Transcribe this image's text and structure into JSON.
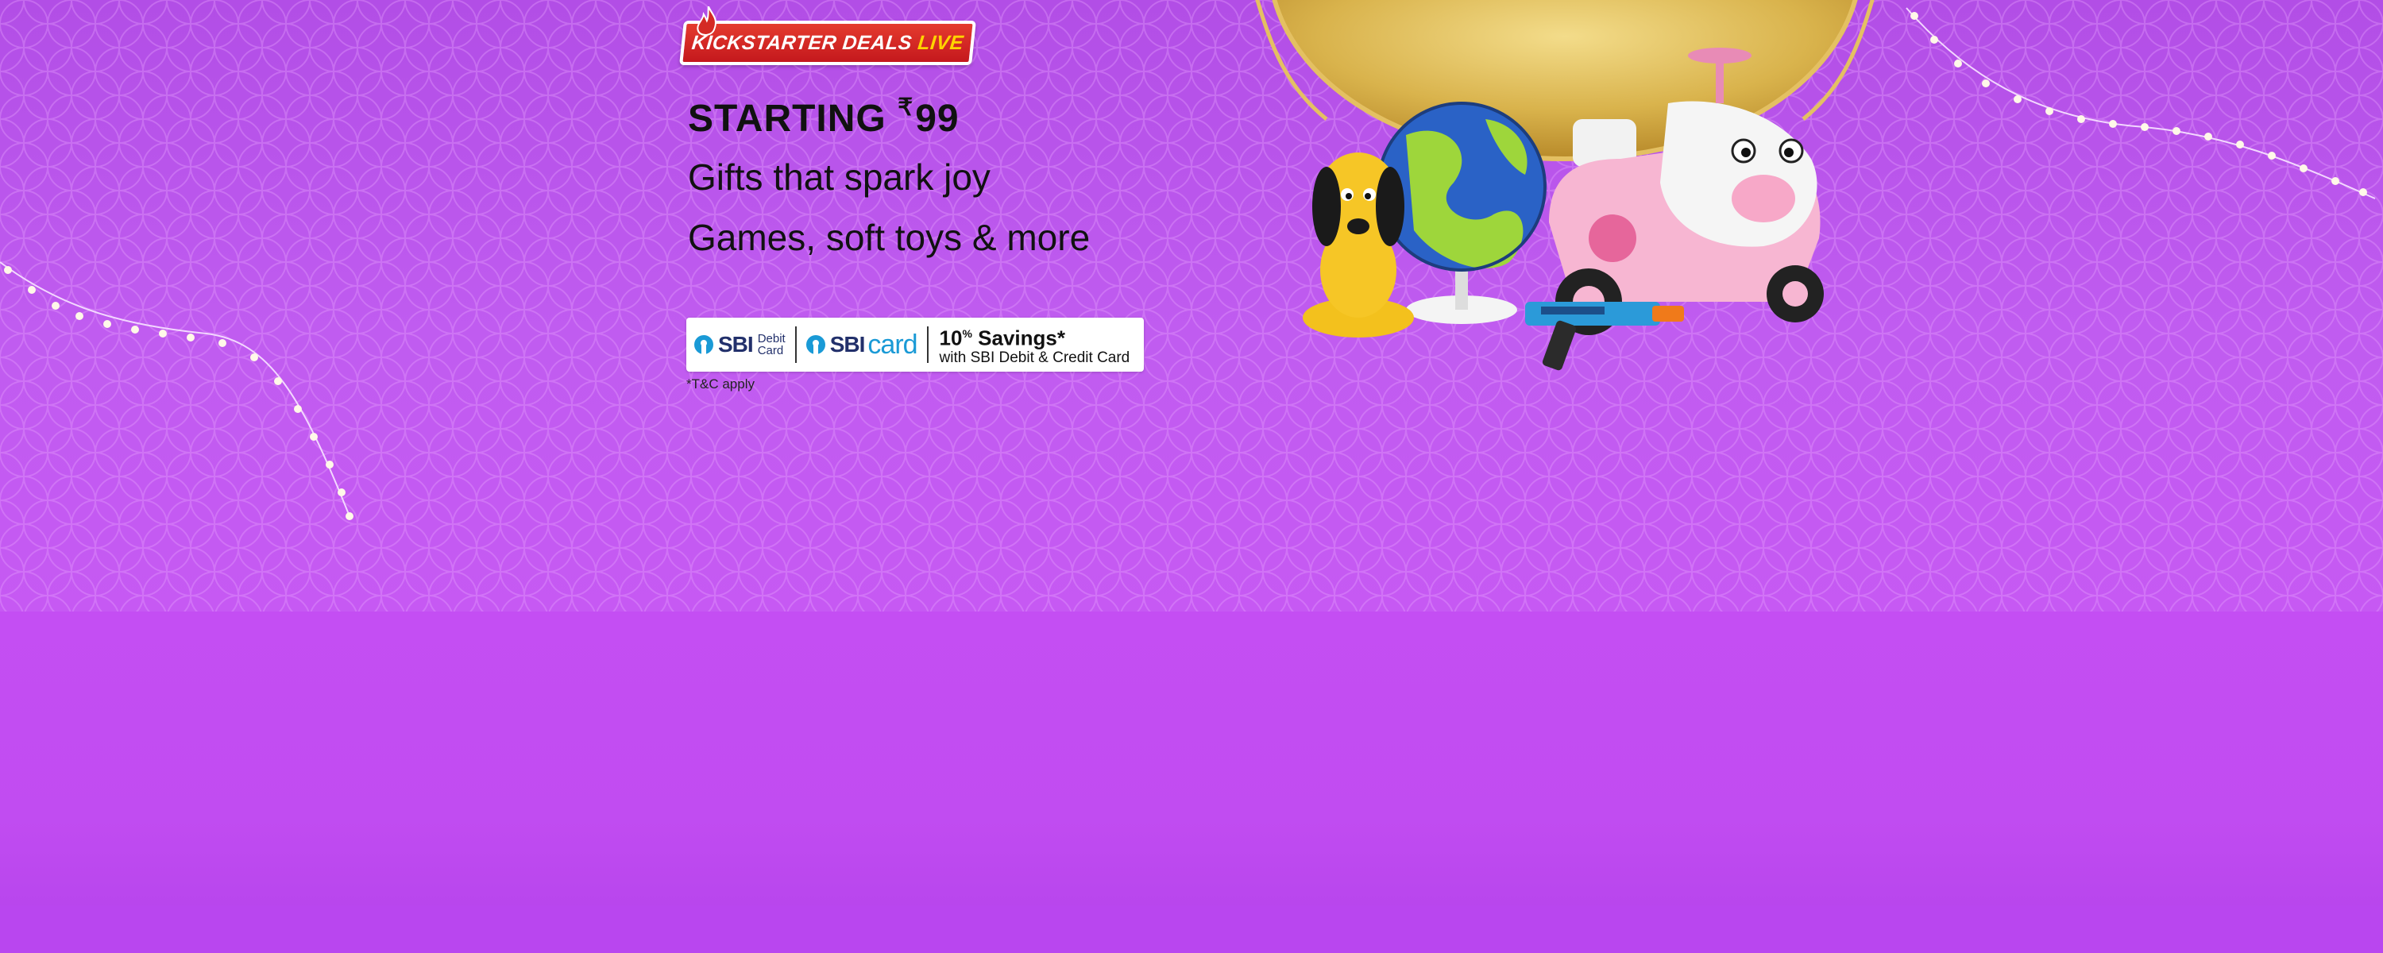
{
  "banner": {
    "badge": {
      "main": "KICKSTARTER DEALS",
      "live": "LIVE"
    },
    "headline": {
      "prefix": "STARTING",
      "currency": "₹",
      "price": "99"
    },
    "line2": "Gifts that spark joy",
    "line3": "Games, soft toys & more",
    "offer": {
      "sbi_brand": "SBI",
      "debit_card_label_1": "Debit",
      "debit_card_label_2": "Card",
      "card_word": "card",
      "savings_percent": "10",
      "percent_sign": "%",
      "savings_label": "Savings*",
      "savings_sub": "with SBI Debit & Credit Card"
    },
    "terms": "*T&C apply",
    "colors": {
      "background": "#c05cf0",
      "badge_red": "#d42a24",
      "live_yellow": "#ffd400",
      "sbi_blue": "#1a9ad6"
    }
  }
}
